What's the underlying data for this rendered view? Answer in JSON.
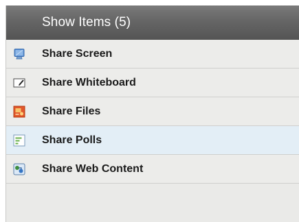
{
  "header": {
    "title": "Show Items (5)"
  },
  "items": [
    {
      "label": "Share Screen",
      "icon": "monitor-icon"
    },
    {
      "label": "Share Whiteboard",
      "icon": "whiteboard-icon"
    },
    {
      "label": "Share Files",
      "icon": "files-presentation-icon"
    },
    {
      "label": "Share Polls",
      "icon": "poll-icon"
    },
    {
      "label": "Share Web Content",
      "icon": "web-content-icon"
    }
  ],
  "colors": {
    "header_bg": "#666666",
    "panel_bg": "#eaeae8",
    "hover_row_bg": "#e3eef6"
  }
}
